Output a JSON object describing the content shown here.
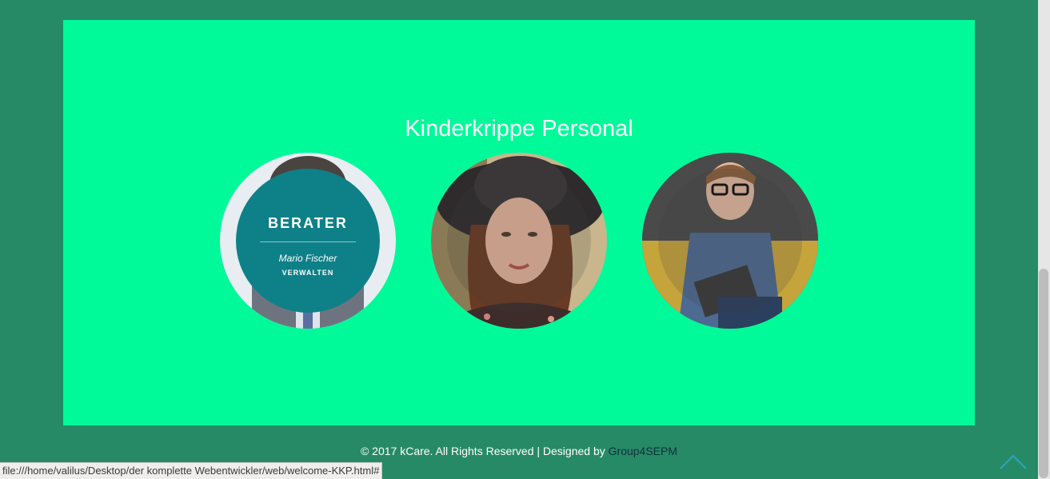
{
  "section": {
    "title": "Kinderkrippe Personal"
  },
  "team": [
    {
      "role": "BERATER",
      "name": "Mario Fischer",
      "action": "VERWALTEN"
    }
  ],
  "footer": {
    "text": "© 2017 kCare. All Rights Reserved | Designed by ",
    "link": "Group4SEPM"
  },
  "status_bar": {
    "url": "file:///home/valilus/Desktop/der komplette Webentwickler/web/welcome-KKP.html#"
  },
  "colors": {
    "page_background": "#268a66",
    "panel_background": "#00fa9a",
    "overlay_teal": "#0e8088",
    "footer_link": "#11303a",
    "to_top_accent": "#2aa5c0"
  },
  "icons": {
    "to_top": "chevron-up-icon"
  }
}
